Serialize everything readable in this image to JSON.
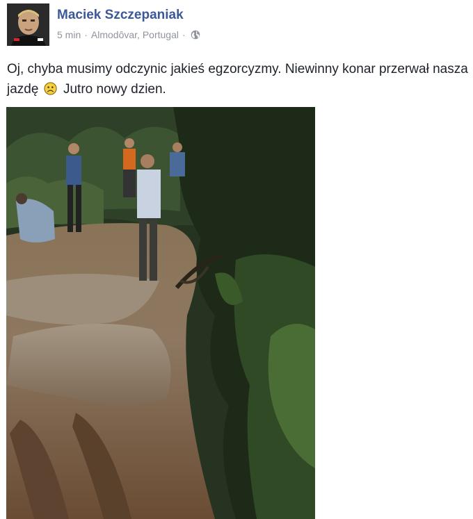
{
  "post": {
    "author": "Maciek Szczepaniak",
    "time": "5 min",
    "separator": "·",
    "location": "Almodôvar, Portugal",
    "privacy_icon": "globe-icon",
    "text_before_emoji": "Oj, chyba musimy odczynic jakieś egzorcyzmy. Niewinny konar przerwał nasza jazdę ",
    "emoji": "frown-emoji-icon",
    "text_after_emoji": " Jutro nowy dzien."
  },
  "colors": {
    "author": "#3b5998",
    "meta": "#90949c",
    "text": "#1d2129"
  }
}
